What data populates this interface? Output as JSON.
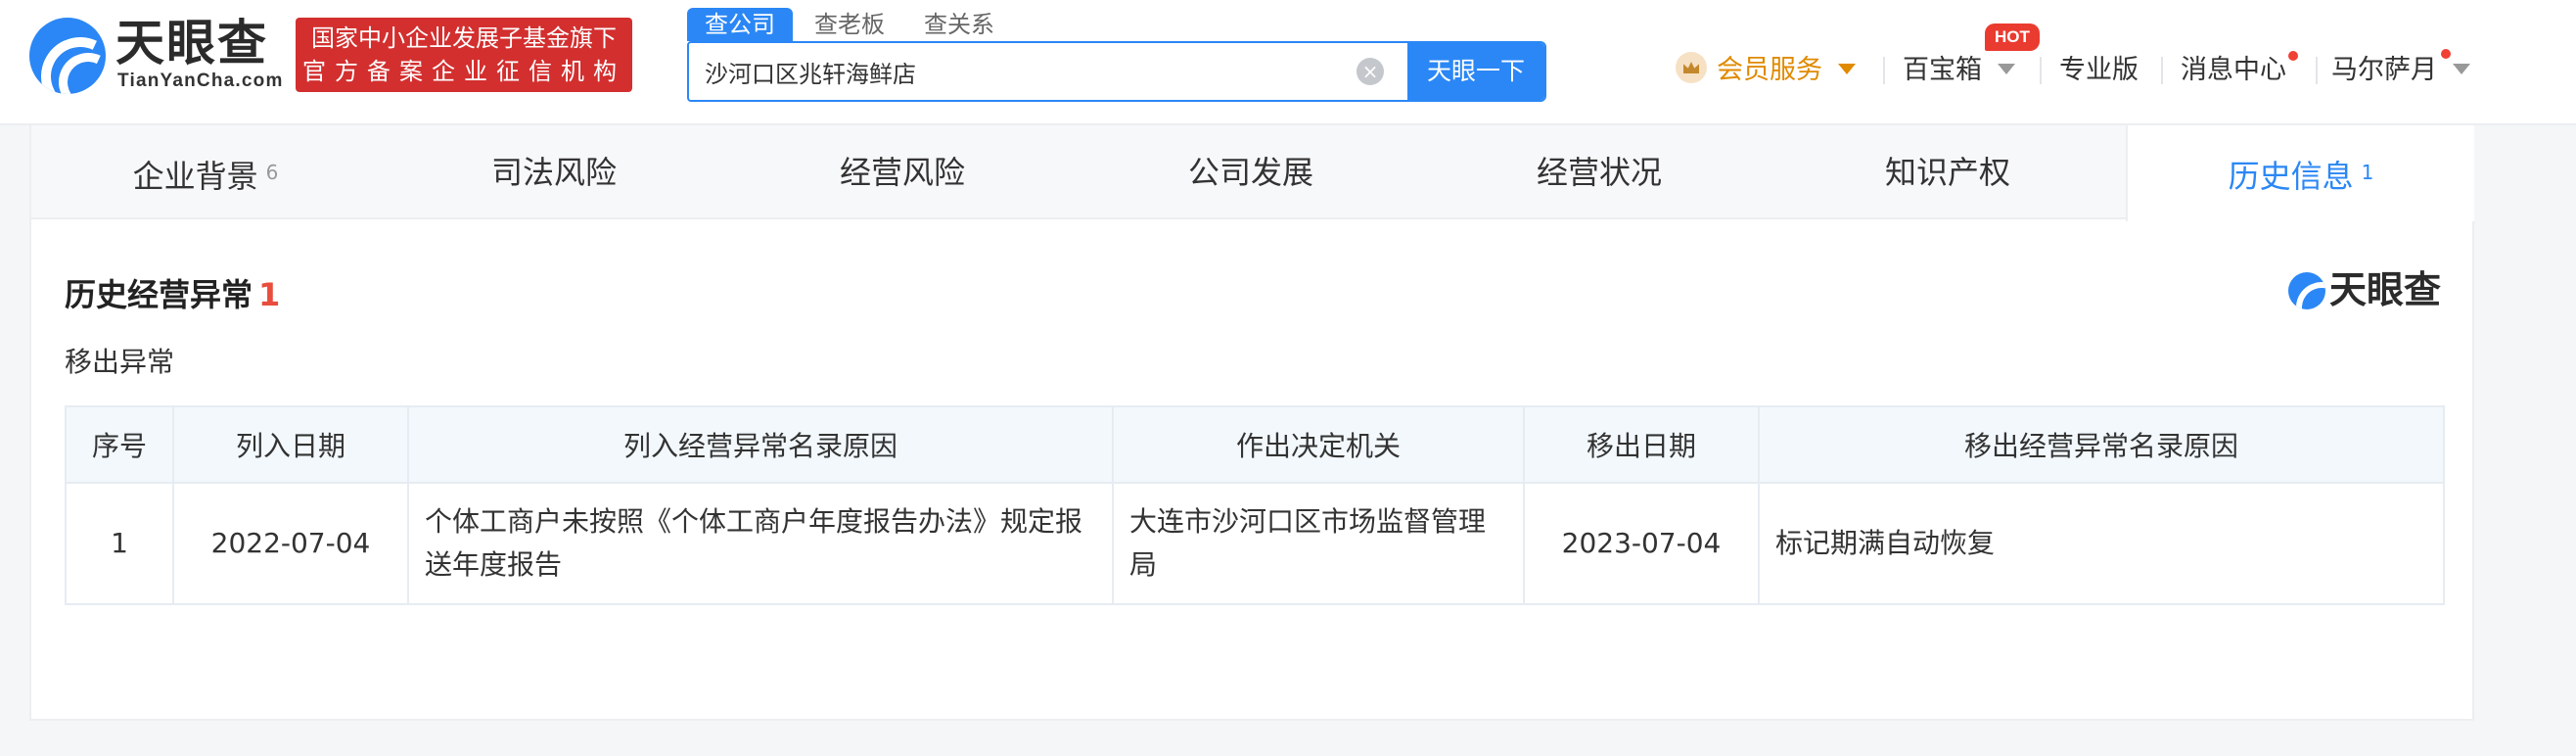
{
  "header": {
    "logo_cn": "天眼查",
    "logo_en": "TianYanCha.com",
    "fund_badge": [
      "国家中小企业发展子基金旗下",
      "官方备案企业征信机构"
    ],
    "search_tabs": [
      "查公司",
      "查老板",
      "查关系"
    ],
    "search_value": "沙河口区兆轩海鲜店",
    "search_button": "天眼一下",
    "nav": {
      "vip": "会员服务",
      "toolbox": "百宝箱",
      "hot": "HOT",
      "pro": "专业版",
      "messages": "消息中心",
      "user": "马尔萨月"
    }
  },
  "tabs": [
    {
      "label": "企业背景",
      "count": "6"
    },
    {
      "label": "司法风险",
      "count": ""
    },
    {
      "label": "经营风险",
      "count": ""
    },
    {
      "label": "公司发展",
      "count": ""
    },
    {
      "label": "经营状况",
      "count": ""
    },
    {
      "label": "知识产权",
      "count": ""
    },
    {
      "label": "历史信息",
      "count": "1"
    }
  ],
  "section": {
    "title": "历史经营异常",
    "count": "1",
    "watermark": "天眼查",
    "subtitle": "移出异常"
  },
  "table": {
    "headers": [
      "序号",
      "列入日期",
      "列入经营异常名录原因",
      "作出决定机关",
      "移出日期",
      "移出经营异常名录原因"
    ],
    "rows": [
      [
        "1",
        "2022-07-04",
        "个体工商户未按照《个体工商户年度报告办法》规定报送年度报告",
        "大连市沙河口区市场监督管理局",
        "2023-07-04",
        "标记期满自动恢复"
      ]
    ]
  },
  "colors": {
    "brand_blue": "#2b87f5",
    "badge_red": "#d32f2f",
    "vip_orange": "#e08a00",
    "count_red": "#e84d3d"
  }
}
